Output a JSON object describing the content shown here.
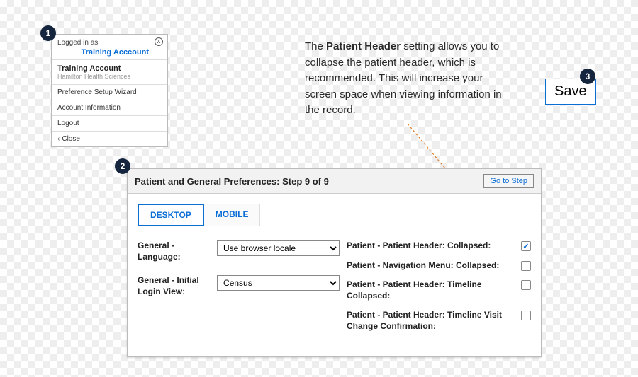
{
  "badges": {
    "one": "1",
    "two": "2",
    "three": "3"
  },
  "user_menu": {
    "logged_in_as": "Logged in as",
    "account_link": "Training Acccount",
    "account_name": "Training Account",
    "org": "Hamilton Health Sciences",
    "items": [
      "Preference Setup Wizard",
      "Account Information",
      "Logout",
      "Close"
    ]
  },
  "description": {
    "bold": "Patient Header",
    "text_after": " setting allows you to collapse the patient header, which is recommended. This will increase your screen space when viewing information in the record.",
    "text_before": "The "
  },
  "save": {
    "label": "Save"
  },
  "prefs": {
    "title": "Patient and General Preferences: Step 9 of 9",
    "go_to_step": "Go to Step",
    "tabs": {
      "desktop": "DESKTOP",
      "mobile": "MOBILE"
    },
    "left": {
      "language_label": "General - Language:",
      "language_value": "Use browser locale",
      "login_view_label": "General - Initial Login View:",
      "login_view_value": "Census"
    },
    "right": {
      "rows": [
        {
          "label": "Patient - Patient Header: Collapsed:",
          "checked": true
        },
        {
          "label": "Patient - Navigation Menu: Collapsed:",
          "checked": false
        },
        {
          "label": "Patient - Patient Header: Timeline Collapsed:",
          "checked": false
        },
        {
          "label": "Patient - Patient Header: Timeline Visit Change Confirmation:",
          "checked": false
        }
      ]
    }
  }
}
